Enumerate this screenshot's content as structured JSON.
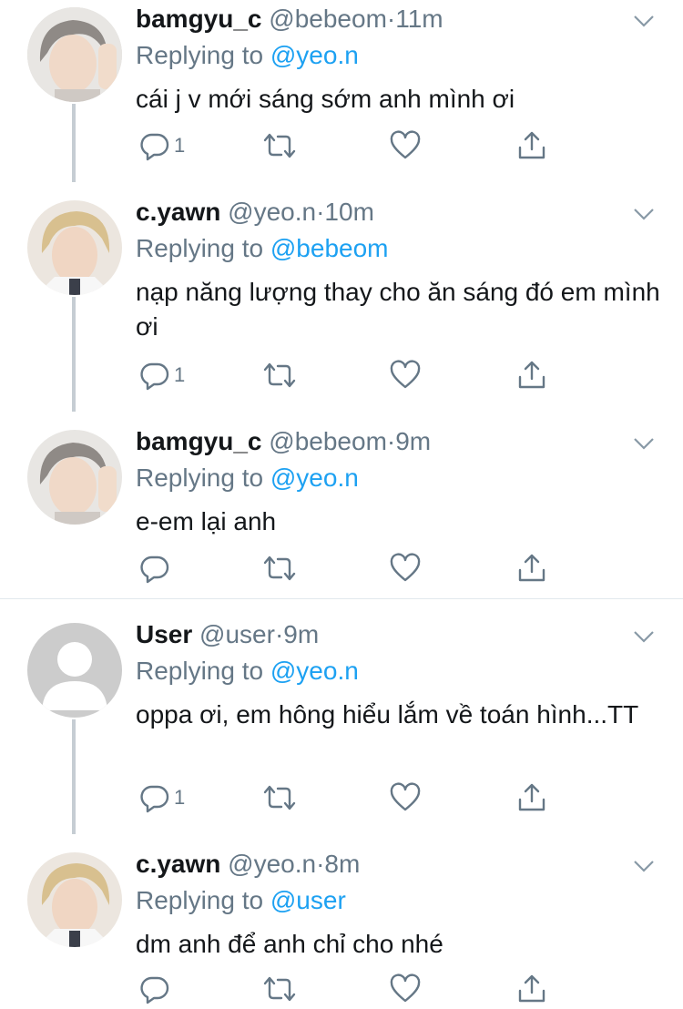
{
  "tweets": [
    {
      "name": "bamgyu_c",
      "handle": "@bebeom",
      "dot": "·",
      "time": "11m",
      "replying_prefix": "Replying to",
      "replying_to": "@yeo.n",
      "text": "cái j v mới sáng sớm anh mình ơi",
      "reply_count": "1",
      "avatar": "photo-gray-hair"
    },
    {
      "name": "c.yawn",
      "handle": "@yeo.n",
      "dot": "·",
      "time": "10m",
      "replying_prefix": "Replying to",
      "replying_to": "@bebeom",
      "text": "nạp năng lượng thay cho ăn sáng đó em mình ơi",
      "reply_count": "1",
      "avatar": "photo-blonde-hair"
    },
    {
      "name": "bamgyu_c",
      "handle": "@bebeom",
      "dot": "·",
      "time": "9m",
      "replying_prefix": "Replying to",
      "replying_to": "@yeo.n",
      "text": "e-em lại anh",
      "reply_count": "",
      "avatar": "photo-gray-hair"
    },
    {
      "name": "User",
      "handle": "@user",
      "dot": "·",
      "time": "9m",
      "replying_prefix": "Replying to",
      "replying_to": "@yeo.n",
      "text": "oppa ơi, em hông hiểu lắm về toán hình...TT",
      "reply_count": "1",
      "avatar": "default-avatar"
    },
    {
      "name": "c.yawn",
      "handle": "@yeo.n",
      "dot": "·",
      "time": "8m",
      "replying_prefix": "Replying to",
      "replying_to": "@user",
      "text": "dm anh để anh chỉ cho nhé",
      "reply_count": "",
      "avatar": "photo-blonde-hair"
    }
  ],
  "icons": {
    "reply": "reply-icon",
    "retweet": "retweet-icon",
    "like": "heart-icon",
    "share": "share-icon",
    "more": "chevron-down-icon"
  },
  "colors": {
    "name": "#14171a",
    "meta": "#657786",
    "mention": "#1da1f2",
    "thread_line": "#c6cdd3"
  }
}
